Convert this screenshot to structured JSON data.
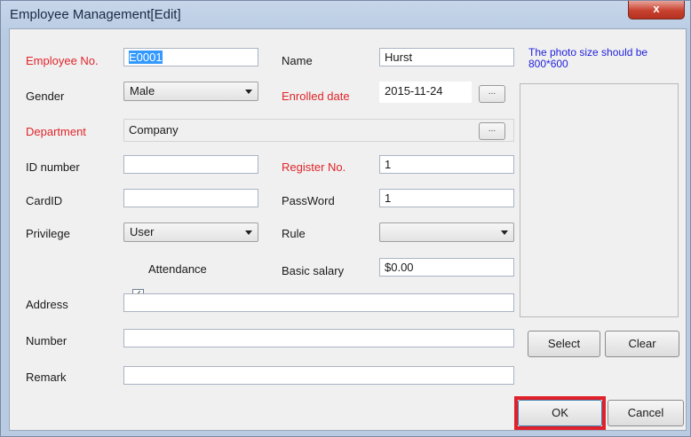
{
  "window": {
    "title": "Employee Management[Edit]",
    "close_glyph": "x"
  },
  "form": {
    "employee_no": {
      "label": "Employee No.",
      "value": "E0001"
    },
    "name": {
      "label": "Name",
      "value": "Hurst"
    },
    "gender": {
      "label": "Gender",
      "value": "Male"
    },
    "enrolled_date": {
      "label": "Enrolled date",
      "value": "2015-11-24"
    },
    "department": {
      "label": "Department",
      "value": "Company"
    },
    "id_number": {
      "label": "ID number",
      "value": ""
    },
    "register_no": {
      "label": "Register No.",
      "value": "1"
    },
    "card_id": {
      "label": "CardID",
      "value": ""
    },
    "password": {
      "label": "PassWord",
      "value": "1"
    },
    "privilege": {
      "label": "Privilege",
      "value": "User"
    },
    "rule": {
      "label": "Rule",
      "value": ""
    },
    "attendance": {
      "label": "Attendance",
      "checked": true,
      "check_glyph": "✓"
    },
    "basic_salary": {
      "label": "Basic salary",
      "value": "$0.00"
    },
    "address": {
      "label": "Address",
      "value": ""
    },
    "number": {
      "label": "Number",
      "value": ""
    },
    "remark": {
      "label": "Remark",
      "value": ""
    },
    "browse_glyph": "..."
  },
  "photo": {
    "hint": "The photo size should be 800*600"
  },
  "buttons": {
    "select": "Select",
    "clear": "Clear",
    "ok": "OK",
    "cancel": "Cancel"
  },
  "colors": {
    "required_label": "#e0252a",
    "hint_text": "#2222dd",
    "highlight": "#e0202a"
  }
}
